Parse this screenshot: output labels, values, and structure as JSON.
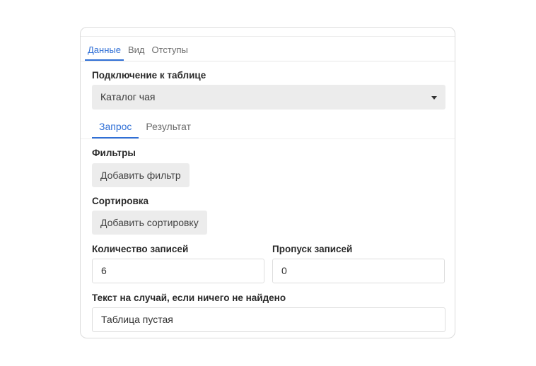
{
  "tabs": {
    "main": [
      "Данные",
      "Вид",
      "Отступы"
    ],
    "sub": [
      "Запрос",
      "Результат"
    ]
  },
  "connection": {
    "label": "Подключение к таблице",
    "selected": "Каталог чая"
  },
  "filters": {
    "label": "Фильтры",
    "button": "Добавить фильтр"
  },
  "sorting": {
    "label": "Сортировка",
    "button": "Добавить сортировку"
  },
  "records_count": {
    "label": "Количество записей",
    "value": "6"
  },
  "records_skip": {
    "label": "Пропуск записей",
    "value": "0"
  },
  "empty_text": {
    "label": "Текст на случай, если ничего не найдено",
    "value": "Таблица пустая"
  },
  "colors": {
    "accent": "#2f6fd6",
    "button_bg": "#ececec",
    "border": "#dcdcdc"
  }
}
